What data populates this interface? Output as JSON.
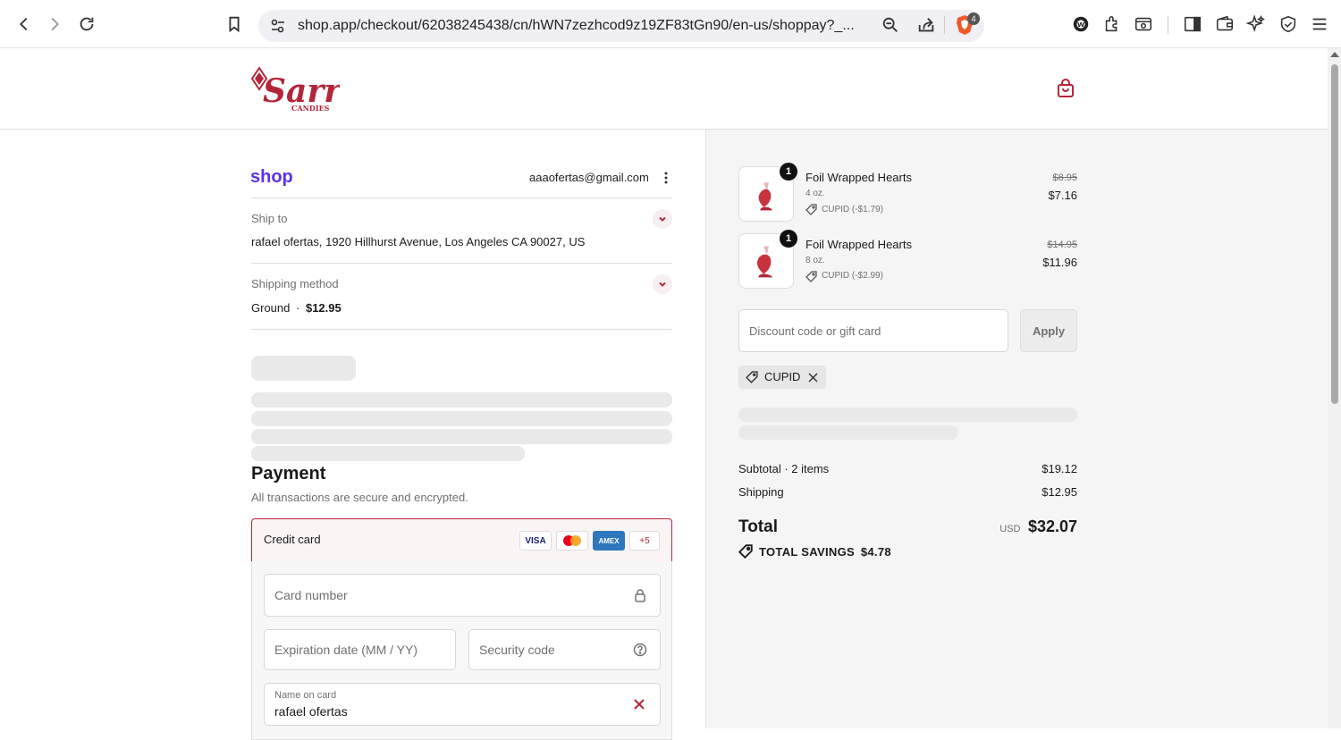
{
  "browser": {
    "url": "shop.app/checkout/62038245438/cn/hWN7zezhcod9z19ZF83tGn90/en-us/shoppay?_...",
    "shield_count": "4"
  },
  "store": {
    "name": "Sarris",
    "tagline": "CANDIES"
  },
  "account": {
    "provider": "shop",
    "email": "aaaofertas@gmail.com"
  },
  "ship_to": {
    "label": "Ship to",
    "address": "rafael ofertas, 1920 Hillhurst Avenue, Los Angeles CA 90027, US"
  },
  "shipping_method": {
    "label": "Shipping method",
    "name": "Ground",
    "separator": "·",
    "price": "$12.95"
  },
  "payment": {
    "title": "Payment",
    "subtitle": "All transactions are secure and encrypted.",
    "method_label": "Credit card",
    "cards": [
      "VISA",
      "AMEX",
      "+5"
    ],
    "card_number_placeholder": "Card number",
    "expiration_placeholder": "Expiration date (MM / YY)",
    "security_placeholder": "Security code",
    "name_label": "Name on card",
    "name_value": "rafael ofertas"
  },
  "cart": {
    "items": [
      {
        "qty": "1",
        "name": "Foil Wrapped Hearts",
        "variant": "4 oz.",
        "discount": "CUPID (-$1.79)",
        "old_price": "$8.95",
        "price": "$7.16"
      },
      {
        "qty": "1",
        "name": "Foil Wrapped Hearts",
        "variant": "8 oz.",
        "discount": "CUPID (-$2.99)",
        "old_price": "$14.95",
        "price": "$11.96"
      }
    ],
    "discount_placeholder": "Discount code or gift card",
    "apply_label": "Apply",
    "applied_code": "CUPID",
    "subtotal_label": "Subtotal · 2 items",
    "subtotal_value": "$19.12",
    "shipping_label": "Shipping",
    "shipping_value": "$12.95",
    "total_label": "Total",
    "currency": "USD",
    "total_value": "$32.07",
    "savings_label": "TOTAL SAVINGS",
    "savings_value": "$4.78"
  },
  "colors": {
    "accent": "#b3263a",
    "shop_purple": "#5a31f4"
  }
}
